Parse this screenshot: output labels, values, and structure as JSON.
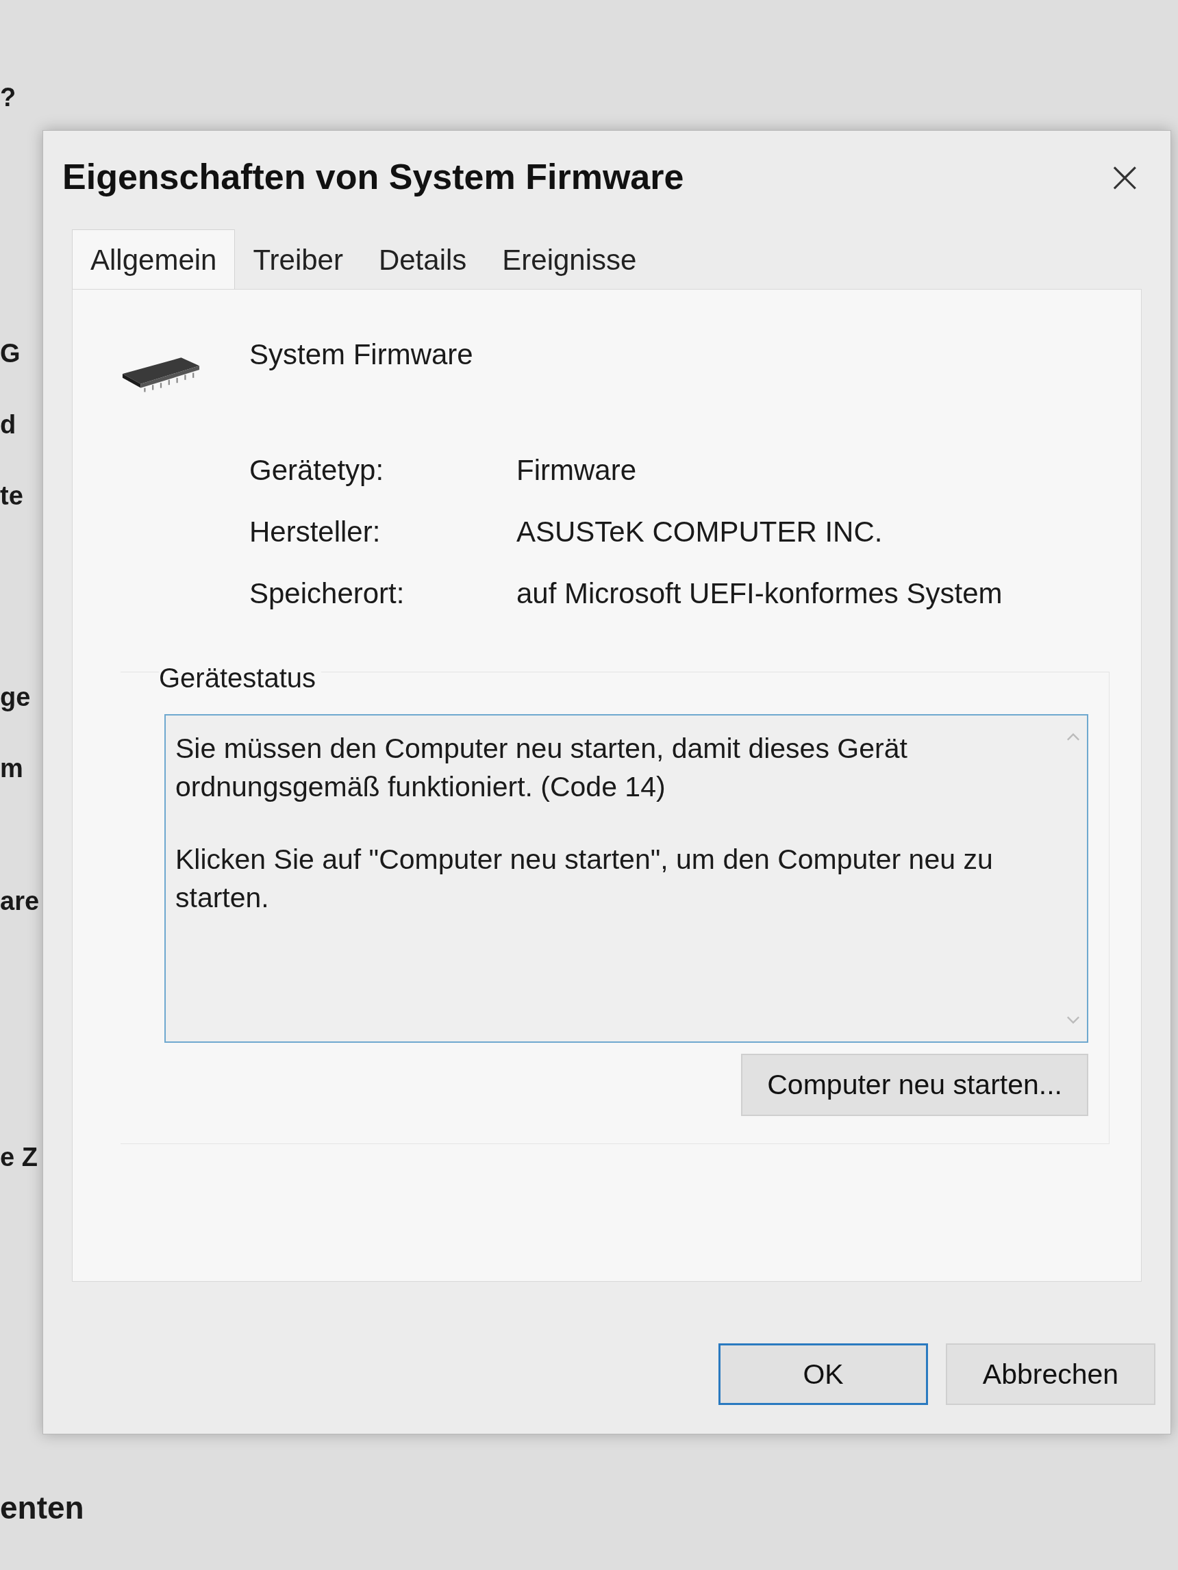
{
  "background_window": {
    "fragments": [
      "?",
      "G",
      "d",
      "te",
      "ge",
      "m",
      "are",
      "e Z"
    ],
    "bottom_text": "enten"
  },
  "dialog": {
    "title": "Eigenschaften von System Firmware",
    "close": "×",
    "tabs": [
      {
        "label": "Allgemein",
        "selected": true
      },
      {
        "label": "Treiber",
        "selected": false
      },
      {
        "label": "Details",
        "selected": false
      },
      {
        "label": "Ereignisse",
        "selected": false
      }
    ],
    "device_name": "System Firmware",
    "properties": [
      {
        "label": "Gerätetyp:",
        "value": "Firmware"
      },
      {
        "label": "Hersteller:",
        "value": "ASUSTeK COMPUTER INC."
      },
      {
        "label": "Speicherort:",
        "value": "auf Microsoft UEFI-konformes System"
      }
    ],
    "status": {
      "heading": "Gerätestatus",
      "paragraphs": [
        "Sie müssen den Computer neu starten, damit dieses Gerät ordnungsgemäß funktioniert. (Code 14)",
        "Klicken Sie auf \"Computer neu starten\", um den Computer neu zu starten."
      ],
      "action": "Computer neu starten..."
    },
    "buttons": [
      {
        "label": "OK",
        "default": true
      },
      {
        "label": "Abbrechen",
        "default": false
      }
    ]
  }
}
